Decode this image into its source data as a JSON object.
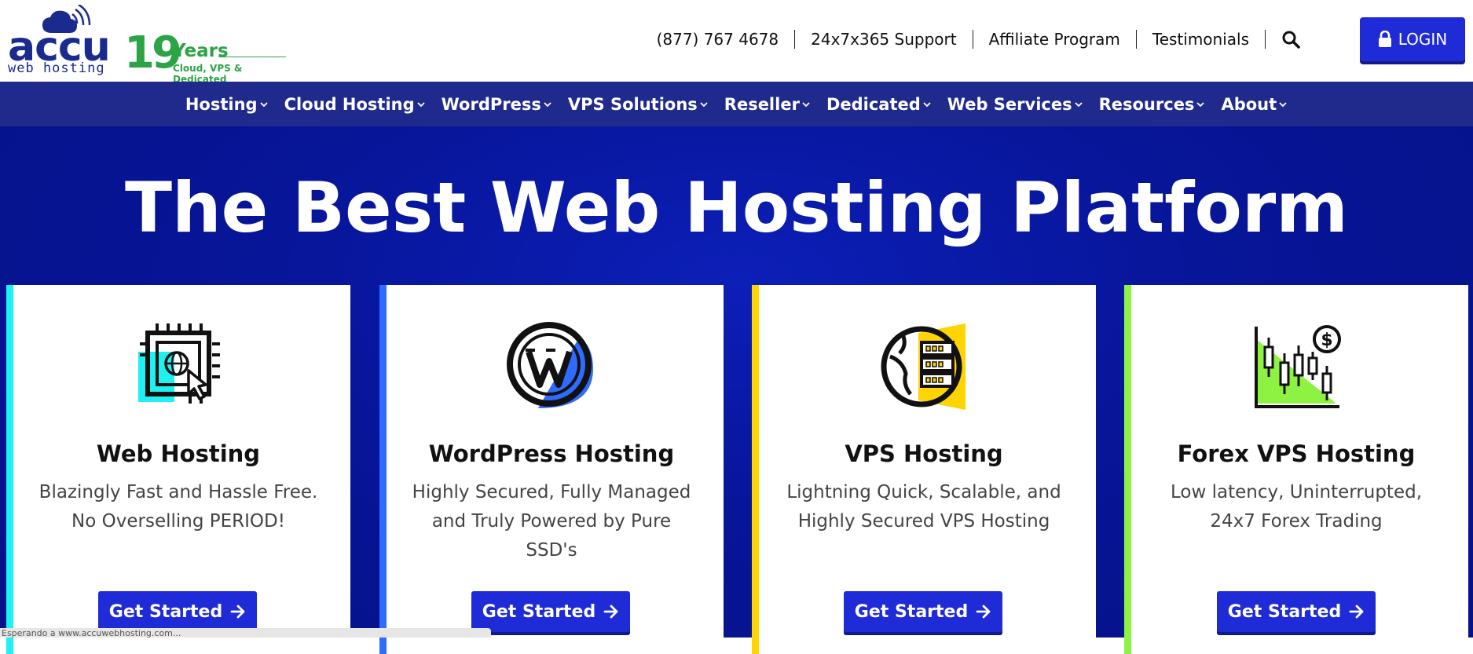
{
  "logo": {
    "brand": "accu",
    "tagline": "web hosting",
    "years_number": "19",
    "years_label": "Years",
    "years_sub": "Cloud, VPS & Dedicated"
  },
  "toplinks": {
    "phone": "(877) 767 4678",
    "support": "24x7x365 Support",
    "affiliate": "Affiliate Program",
    "testimonials": "Testimonials"
  },
  "login": {
    "label": "LOGIN",
    "icon": "lock-icon"
  },
  "nav": [
    "Hosting",
    "Cloud Hosting",
    "WordPress",
    "VPS Solutions",
    "Reseller",
    "Dedicated",
    "Web Services",
    "Resources",
    "About"
  ],
  "hero": {
    "title": "The Best Web Hosting Platform"
  },
  "cards": [
    {
      "title": "Web Hosting",
      "desc": "Blazingly Fast and Hassle Free. No Overselling PERIOD!",
      "button": "Get Started",
      "accent": "#1ff0f0",
      "icon": "web-hosting-chip-icon"
    },
    {
      "title": "WordPress Hosting",
      "desc": "Highly Secured, Fully Managed and Truly Powered by Pure SSD's",
      "button": "Get Started",
      "accent": "#2f6bff",
      "icon": "wordpress-icon"
    },
    {
      "title": "VPS Hosting",
      "desc": "Lightning Quick, Scalable, and Highly Secured VPS Hosting",
      "button": "Get Started",
      "accent": "#ffd400",
      "icon": "vps-server-globe-icon"
    },
    {
      "title": "Forex VPS Hosting",
      "desc": "Low latency, Uninterrupted, 24x7 Forex Trading",
      "button": "Get Started",
      "accent": "#8ef243",
      "icon": "forex-candlestick-icon"
    }
  ],
  "status": {
    "text": "Esperando a www.accuwebhosting.com..."
  }
}
